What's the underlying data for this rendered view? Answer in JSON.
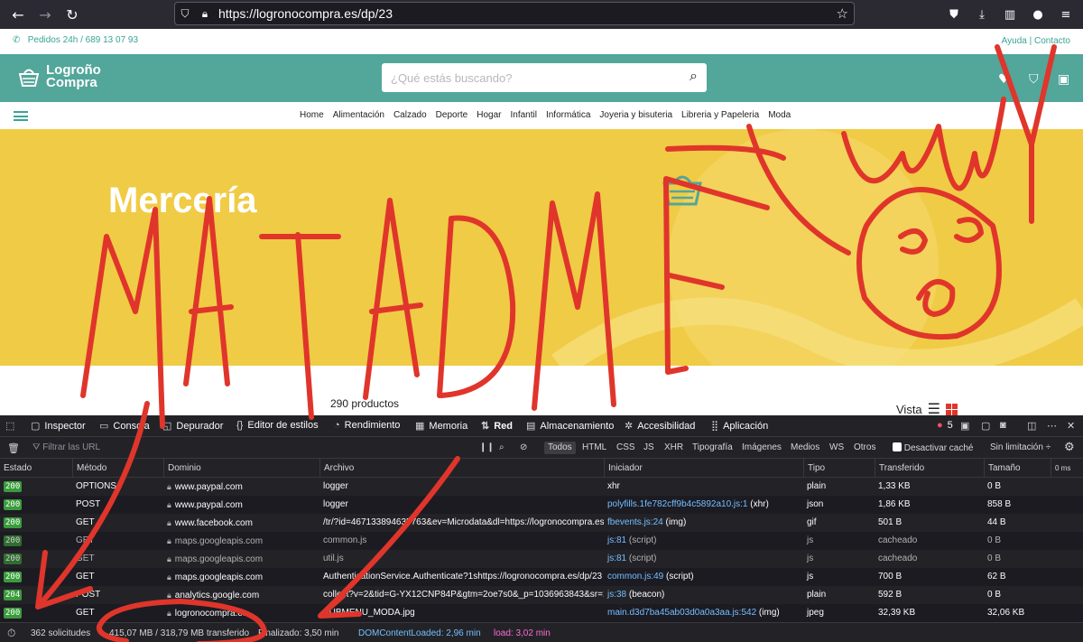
{
  "browser": {
    "url": "https://logronocompra.es/dp/23"
  },
  "site": {
    "phone_text": "Pedidos 24h / 689 13 07 93",
    "help_text": "Ayuda | Contacto",
    "logo_line1": "Logroño",
    "logo_line2": "Compra",
    "search_placeholder": "¿Qué estás buscando?",
    "menu": [
      "Home",
      "Alimentación",
      "Calzado",
      "Deporte",
      "Hogar",
      "Infantil",
      "Informática",
      "Joyeria y bisuteria",
      "Libreria y Papeleria",
      "Moda"
    ],
    "banner_title": "Mercería",
    "product_count": "290 productos",
    "view_label": "Vista",
    "colors": {
      "teal": "#52a69a",
      "banner": "#f0cb45",
      "accent_red": "#e0352b"
    }
  },
  "devtools": {
    "tabs": [
      "Inspector",
      "Consola",
      "Depurador",
      "Editor de estilos",
      "Rendimiento",
      "Memoria",
      "Red",
      "Almacenamiento",
      "Accesibilidad",
      "Aplicación"
    ],
    "active_tab": "Red",
    "error_count": "5",
    "filter_placeholder": "Filtrar las URL",
    "types": [
      "Todos",
      "HTML",
      "CSS",
      "JS",
      "XHR",
      "Tipografía",
      "Imágenes",
      "Medios",
      "WS",
      "Otros"
    ],
    "disable_cache": "Desactivar caché",
    "throttle": "Sin limitación ÷",
    "columns": [
      "Estado",
      "Método",
      "Dominio",
      "Archivo",
      "Iniciador",
      "Tipo",
      "Transferido",
      "Tamaño",
      "0 ms"
    ],
    "rows": [
      {
        "status": "200",
        "method": "OPTIONS",
        "domain": "www.paypal.com",
        "file": "logger",
        "initiator": "xhr",
        "initiator_link": "",
        "type": "plain",
        "transferred": "1,33 KB",
        "size": "0 B",
        "cached": false
      },
      {
        "status": "200",
        "method": "POST",
        "domain": "www.paypal.com",
        "file": "logger",
        "initiator": " (xhr)",
        "initiator_link": "polyfills.1fe782cff9b4c5892a10.js:1",
        "type": "json",
        "transferred": "1,86 KB",
        "size": "858 B",
        "cached": false
      },
      {
        "status": "200",
        "method": "GET",
        "domain": "www.facebook.com",
        "file": "/tr/?id=467133894635763&ev=Microdata&dl=https://logronocompra.es/dp/23",
        "initiator": " (img)",
        "initiator_link": "fbevents.js:24",
        "type": "gif",
        "transferred": "501 B",
        "size": "44 B",
        "cached": false
      },
      {
        "status": "200",
        "method": "GET",
        "domain": "maps.googleapis.com",
        "file": "common.js",
        "initiator": " (script)",
        "initiator_link": "js:81",
        "type": "js",
        "transferred": "cacheado",
        "size": "0 B",
        "cached": true
      },
      {
        "status": "200",
        "method": "GET",
        "domain": "maps.googleapis.com",
        "file": "util.js",
        "initiator": " (script)",
        "initiator_link": "js:81",
        "type": "js",
        "transferred": "cacheado",
        "size": "0 B",
        "cached": true
      },
      {
        "status": "200",
        "method": "GET",
        "domain": "maps.googleapis.com",
        "file": "AuthenticationService.Authenticate?1shttps://logronocompra.es/dp/23",
        "initiator": " (script)",
        "initiator_link": "common.js:49",
        "type": "js",
        "transferred": "700 B",
        "size": "62 B",
        "cached": false
      },
      {
        "status": "204",
        "method": "POST",
        "domain": "analytics.google.com",
        "file": "collect?v=2&tid=G-YX12CNP84P&gtm=2oe7s0&_p=1036963843&sr=1",
        "initiator": " (beacon)",
        "initiator_link": "js:38",
        "type": "plain",
        "transferred": "592 B",
        "size": "0 B",
        "cached": false
      },
      {
        "status": "200",
        "method": "GET",
        "domain": "logronocompra.es",
        "file": "SUBMENU_MODA.jpg",
        "initiator": " (img)",
        "initiator_link": "main.d3d7ba45ab03d0a0a3aa.js:542",
        "type": "jpeg",
        "transferred": "32,39 KB",
        "size": "32,06 KB",
        "cached": false
      }
    ],
    "status_bar": {
      "requests": "362 solicitudes",
      "transferred": "415,07 MB / 318,79 MB transferido",
      "finished": "Finalizado: 3,50 min",
      "dom_loaded": "DOMContentLoaded: 2,96 min",
      "load": "load: 3,02 min"
    }
  },
  "annotation": {
    "handwritten_text": "MATADME"
  }
}
